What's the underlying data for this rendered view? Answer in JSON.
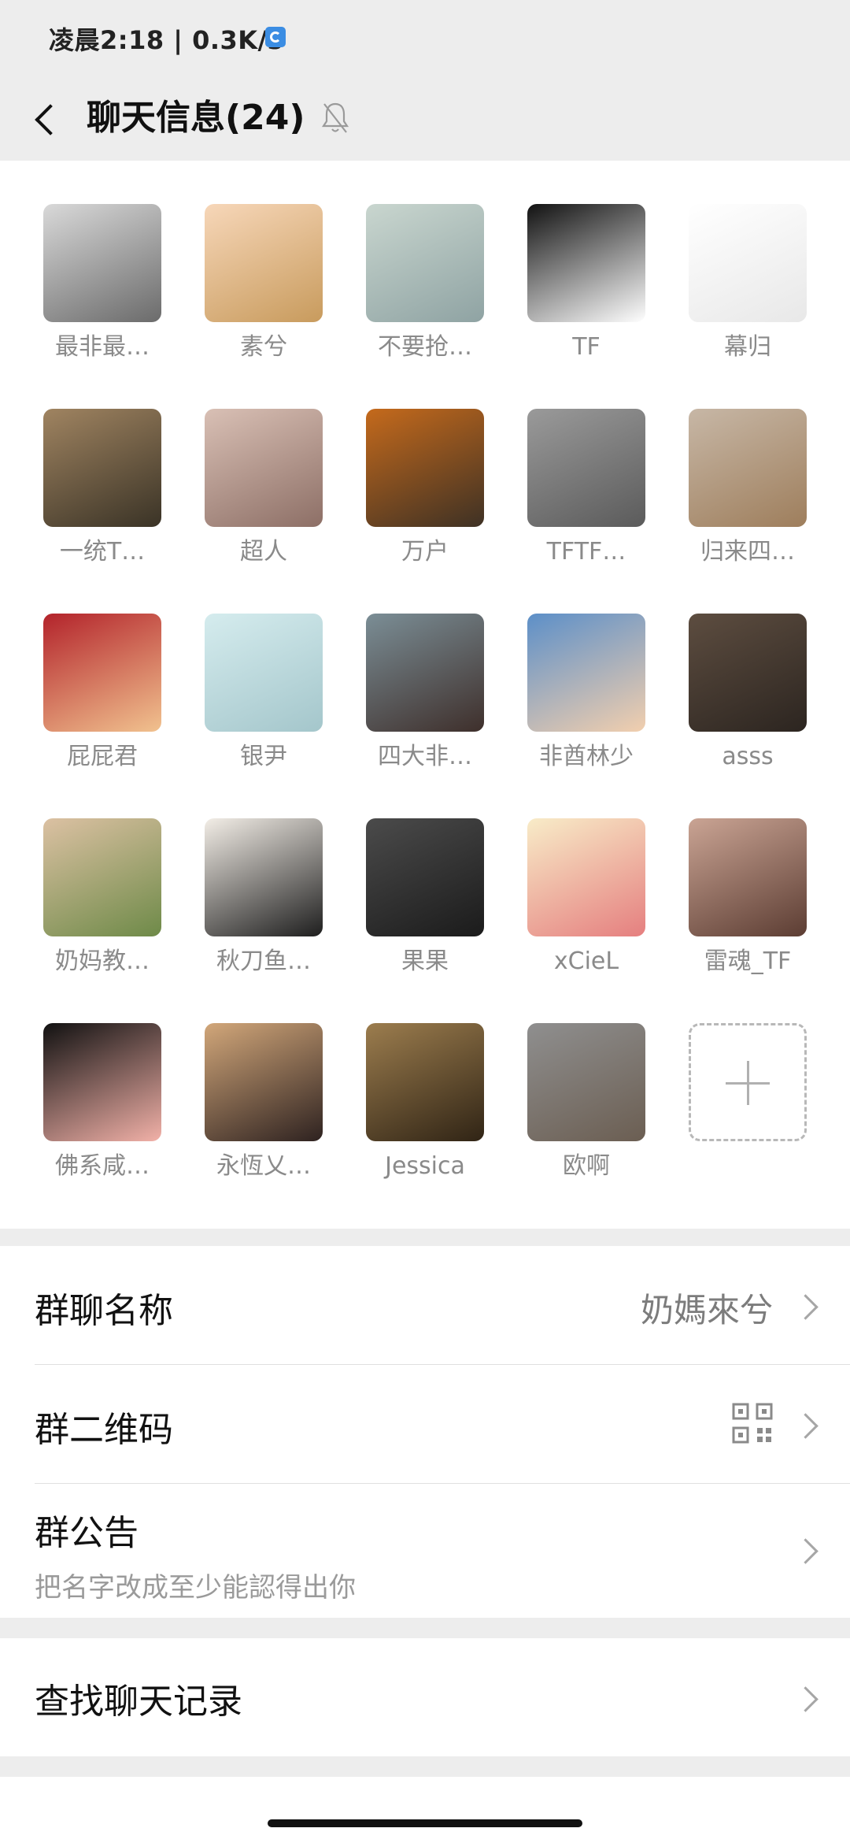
{
  "status_bar": {
    "text": "凌晨2:18 | 0.3K/s"
  },
  "nav": {
    "title": "聊天信息(24)"
  },
  "members": [
    {
      "name": "最非最…",
      "avatar": "ink-warrior-avatar",
      "colors": [
        "#d9d9d9",
        "#6b6b6b"
      ]
    },
    {
      "name": "素兮",
      "avatar": "anime-girl-mouse-ears-avatar",
      "colors": [
        "#f7d7b9",
        "#c89b5d"
      ]
    },
    {
      "name": "不要抢…",
      "avatar": "calligraphy-avatar",
      "colors": [
        "#c9d6cf",
        "#8fa3a3"
      ]
    },
    {
      "name": "TF",
      "avatar": "tf-logo-avatar",
      "colors": [
        "#111111",
        "#ffffff"
      ]
    },
    {
      "name": "幕归",
      "avatar": "white-bunny-avatar",
      "colors": [
        "#ffffff",
        "#e8e8e8"
      ]
    },
    {
      "name": "一统T…",
      "avatar": "sunset-ruins-avatar",
      "colors": [
        "#a08461",
        "#3a3326"
      ]
    },
    {
      "name": "超人",
      "avatar": "sketch-boy-avatar",
      "colors": [
        "#d9c0b5",
        "#8d6f66"
      ]
    },
    {
      "name": "万户",
      "avatar": "excavator-avatar",
      "colors": [
        "#c56a1c",
        "#3e3124"
      ]
    },
    {
      "name": "TFTF…",
      "avatar": "crescent-moon-avatar",
      "colors": [
        "#9a9a9a",
        "#5b5b5b"
      ]
    },
    {
      "name": "归来四…",
      "avatar": "shiba-hat-avatar",
      "colors": [
        "#c7b7a6",
        "#9e7e5c"
      ]
    },
    {
      "name": "屁屁君",
      "avatar": "red-calligraphy-avatar",
      "colors": [
        "#b3232b",
        "#f1c28f"
      ]
    },
    {
      "name": "银尹",
      "avatar": "mint-boy-avatar",
      "colors": [
        "#d5ecee",
        "#a4c6cb"
      ]
    },
    {
      "name": "四大非…",
      "avatar": "round-mirror-avatar",
      "colors": [
        "#7b8e96",
        "#3e2f2b"
      ]
    },
    {
      "name": "非酋林少",
      "avatar": "anime-boy-wink-avatar",
      "colors": [
        "#5c8fc8",
        "#f2cfae"
      ]
    },
    {
      "name": "asss",
      "avatar": "boy-photo-avatar",
      "colors": [
        "#5d4d40",
        "#2c2520"
      ]
    },
    {
      "name": "奶妈教…",
      "avatar": "child-toy-car-avatar",
      "colors": [
        "#dcc1a3",
        "#6e8a48"
      ]
    },
    {
      "name": "秋刀鱼…",
      "avatar": "hat-glasses-man-avatar",
      "colors": [
        "#f3eee7",
        "#1e1e1e"
      ]
    },
    {
      "name": "果果",
      "avatar": "steering-wheel-avatar",
      "colors": [
        "#4b4b4b",
        "#1b1b1b"
      ]
    },
    {
      "name": "xCieL",
      "avatar": "baby-sticker-avatar",
      "colors": [
        "#f8ecc8",
        "#e57f7f"
      ]
    },
    {
      "name": "雷魂_TF",
      "avatar": "couple-photo-avatar",
      "colors": [
        "#caa494",
        "#5c3d33"
      ]
    },
    {
      "name": "佛系咸…",
      "avatar": "fist-flag-avatar",
      "colors": [
        "#111111",
        "#f2b1a8"
      ]
    },
    {
      "name": "永恆乂…",
      "avatar": "anime-girl-braid-avatar",
      "colors": [
        "#d2a77a",
        "#2e2220"
      ]
    },
    {
      "name": "Jessica",
      "avatar": "boy-walking-avatar",
      "colors": [
        "#9c7d4e",
        "#302415"
      ]
    },
    {
      "name": "欧啊",
      "avatar": "mountain-avatar",
      "colors": [
        "#8f8f8f",
        "#6b5e52"
      ]
    }
  ],
  "add_member": {
    "icon": "plus-icon"
  },
  "settings": {
    "group_name_label": "群聊名称",
    "group_name_value": "奶媽來兮",
    "qr_label": "群二维码",
    "notice_label": "群公告",
    "notice_text": "把名字改成至少能認得出你",
    "search_label": "查找聊天记录"
  }
}
